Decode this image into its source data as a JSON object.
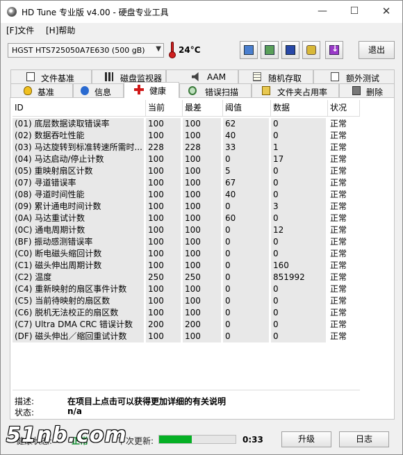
{
  "window": {
    "title": "HD Tune 专业版 v4.00 - 硬盘专业工具",
    "controls": {
      "minimize": "—",
      "maximize": "☐",
      "close": "✕"
    }
  },
  "menu": {
    "file": "[F]文件",
    "help": "[H]帮助"
  },
  "toolbar": {
    "drive": "HGST HTS725050A7E630 (500 gB)",
    "temperature": "24°C",
    "exit_label": "退出",
    "icons": [
      "copy-text-icon",
      "copy-screenshot-icon",
      "save-icon",
      "options-icon",
      "download-icon"
    ]
  },
  "tabs_top": [
    "文件基准",
    "磁盘监视器",
    "AAM",
    "随机存取",
    "额外测试"
  ],
  "tabs_bottom": [
    "基准",
    "信息",
    "健康",
    "错误扫描",
    "文件夹占用率",
    "删除"
  ],
  "active_tab": "健康",
  "smart": {
    "headers": [
      "ID",
      "当前",
      "最差",
      "阈值",
      "数据",
      "状况"
    ],
    "rows": [
      [
        "(01) 底层数据读取错误率",
        "100",
        "100",
        "62",
        "0",
        "正常"
      ],
      [
        "(02) 数据吞吐性能",
        "100",
        "100",
        "40",
        "0",
        "正常"
      ],
      [
        "(03) 马达旋转到标准转速所需时...",
        "228",
        "228",
        "33",
        "1",
        "正常"
      ],
      [
        "(04) 马达启动/停止计数",
        "100",
        "100",
        "0",
        "17",
        "正常"
      ],
      [
        "(05) 重映射扇区计数",
        "100",
        "100",
        "5",
        "0",
        "正常"
      ],
      [
        "(07) 寻道错误率",
        "100",
        "100",
        "67",
        "0",
        "正常"
      ],
      [
        "(08) 寻道时间性能",
        "100",
        "100",
        "40",
        "0",
        "正常"
      ],
      [
        "(09) 累计通电时间计数",
        "100",
        "100",
        "0",
        "3",
        "正常"
      ],
      [
        "(0A) 马达重试计数",
        "100",
        "100",
        "60",
        "0",
        "正常"
      ],
      [
        "(0C) 通电周期计数",
        "100",
        "100",
        "0",
        "12",
        "正常"
      ],
      [
        "(BF) 振动感测错误率",
        "100",
        "100",
        "0",
        "0",
        "正常"
      ],
      [
        "(C0) 断电磁头缩回计数",
        "100",
        "100",
        "0",
        "0",
        "正常"
      ],
      [
        "(C1) 磁头伸出周期计数",
        "100",
        "100",
        "0",
        "160",
        "正常"
      ],
      [
        "(C2) 温度",
        "250",
        "250",
        "0",
        "851992",
        "正常"
      ],
      [
        "(C4) 重新映射的扇区事件计数",
        "100",
        "100",
        "0",
        "0",
        "正常"
      ],
      [
        "(C5) 当前待映射的扇区数",
        "100",
        "100",
        "0",
        "0",
        "正常"
      ],
      [
        "(C6) 脱机无法校正的扇区数",
        "100",
        "100",
        "0",
        "0",
        "正常"
      ],
      [
        "(C7) Ultra DMA CRC 错误计数",
        "200",
        "200",
        "0",
        "0",
        "正常"
      ],
      [
        "(DF) 磁头伸出／缩回重试计数",
        "100",
        "100",
        "0",
        "0",
        "正常"
      ]
    ]
  },
  "details": {
    "desc_label": "描述:",
    "desc_text": "在项目上点击可以获得更加详细的有关说明",
    "status_label": "状态:",
    "status_value": "n/a"
  },
  "footer": {
    "health_label": "健康状态:",
    "health_value": "正常",
    "update_label": "下次更新:",
    "progress": 0.43,
    "countdown": "0:33",
    "upgrade_label": "升级",
    "log_label": "日志"
  },
  "watermark": "51nb.com",
  "colors": {
    "health_ok": "#0a8a2a",
    "progress_fill": "#06b025",
    "active_tab_icon": "#d01818"
  }
}
